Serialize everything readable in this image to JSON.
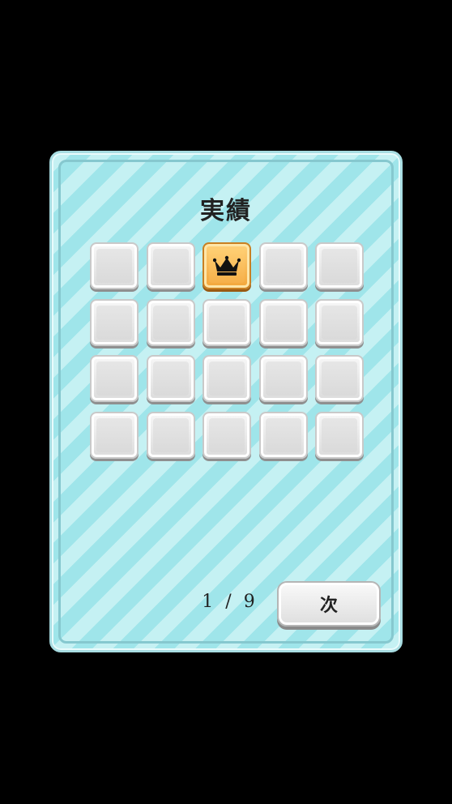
{
  "title": "実績",
  "achievements": [
    {
      "unlocked": false
    },
    {
      "unlocked": false
    },
    {
      "unlocked": true,
      "icon": "crown-icon"
    },
    {
      "unlocked": false
    },
    {
      "unlocked": false
    },
    {
      "unlocked": false
    },
    {
      "unlocked": false
    },
    {
      "unlocked": false
    },
    {
      "unlocked": false
    },
    {
      "unlocked": false
    },
    {
      "unlocked": false
    },
    {
      "unlocked": false
    },
    {
      "unlocked": false
    },
    {
      "unlocked": false
    },
    {
      "unlocked": false
    },
    {
      "unlocked": false
    },
    {
      "unlocked": false
    },
    {
      "unlocked": false
    },
    {
      "unlocked": false
    },
    {
      "unlocked": false
    }
  ],
  "pagination": {
    "indicator": "1 / 9",
    "current_page": 1,
    "total_pages": 9,
    "next_label": "次"
  },
  "colors": {
    "background": "#000000",
    "panel_stripe_light": "#c5f1f3",
    "panel_stripe_dark": "#9fe5ea",
    "unlocked_gold": "#f3a63a",
    "locked_gray": "#dcdcdc"
  }
}
